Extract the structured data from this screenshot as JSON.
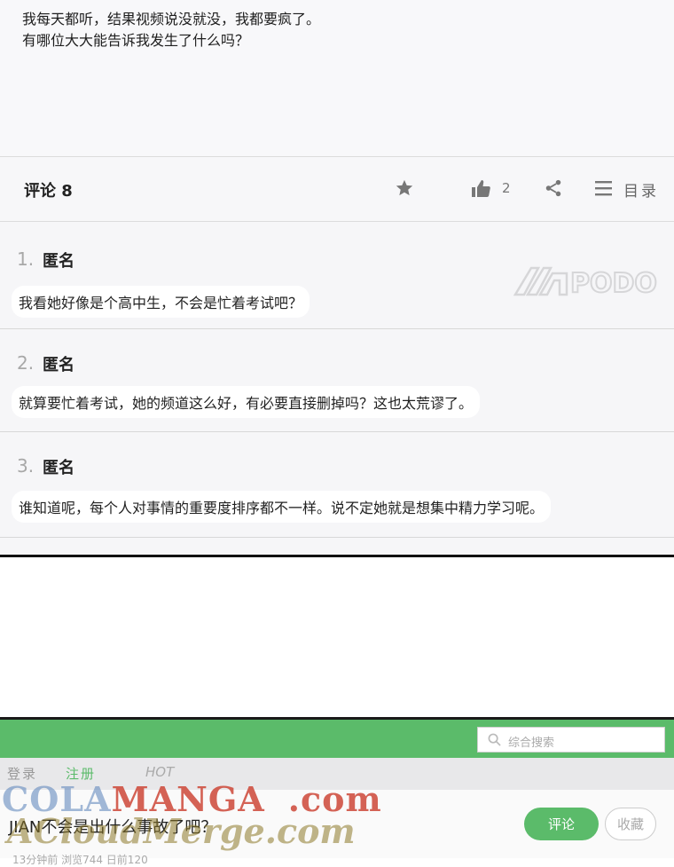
{
  "post": {
    "line1": "我每天都听，结果视频说没就没，我都要疯了。",
    "line2": "有哪位大大能告诉我发生了什么吗？"
  },
  "toolbar": {
    "comments_label": "评论 8",
    "likes": "2",
    "toc_label": "目录"
  },
  "comments": [
    {
      "num": "1.",
      "author": "匿名",
      "text": "我看她好像是个高中生，不会是忙着考试吧？"
    },
    {
      "num": "2.",
      "author": "匿名",
      "text": "就算要忙着考试，她的频道这么好，有必要直接删掉吗？这也太荒谬了。"
    },
    {
      "num": "3.",
      "author": "匿名",
      "text": "谁知道呢，每个人对事情的重要度排序都不一样。说不定她就是想集中精力学习呢。"
    }
  ],
  "watermarks": {
    "podo": "PODO",
    "cola_a": "COLA",
    "cola_b": "MANGA",
    "cola_c": ".com",
    "acloud": "ACloudMerge.com"
  },
  "forum": {
    "search_placeholder": "综合搜索",
    "nav_login": "登录",
    "nav_register": "注册",
    "nav_hot": "HOT",
    "thread_title": "JIAN不会是出什么事故了吧？",
    "thread_meta": "13分钟前 浏览744 日前120",
    "comment_button": "评论",
    "favorite_button": "收藏"
  },
  "colors": {
    "accent_green": "#5bbb6a",
    "divider": "#111111"
  },
  "icons": [
    "star-icon",
    "thumbs-up-icon",
    "share-icon",
    "list-icon",
    "search-icon"
  ]
}
